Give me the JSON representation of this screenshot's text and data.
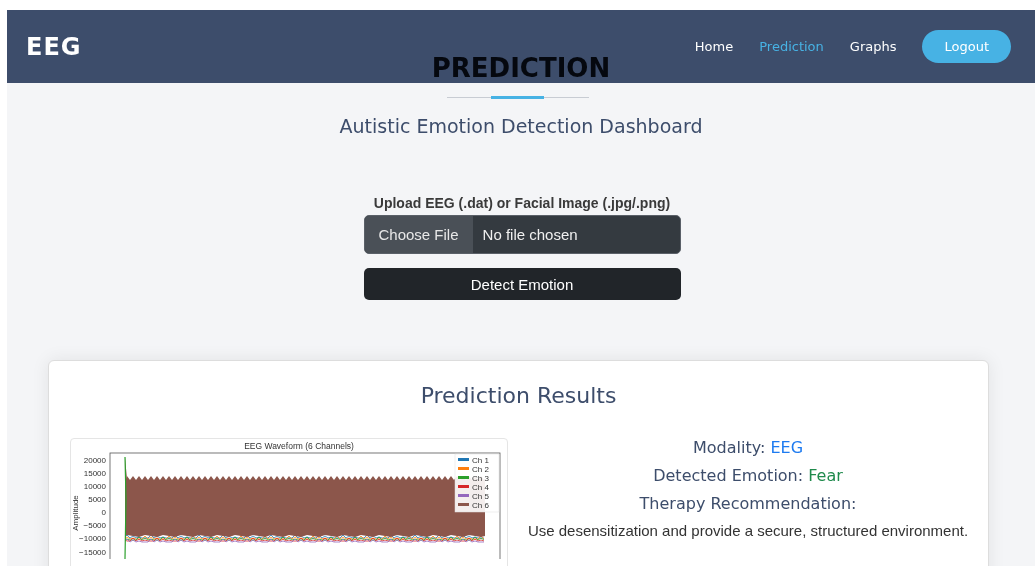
{
  "navbar": {
    "brand": "EEG",
    "links": [
      {
        "label": "Home",
        "selected": false
      },
      {
        "label": "Prediction",
        "selected": true
      },
      {
        "label": "Graphs",
        "selected": false
      }
    ],
    "logout": "Logout"
  },
  "page_title": "PREDICTION",
  "subtitle": "Autistic Emotion Detection Dashboard",
  "upload": {
    "label": "Upload EEG (.dat) or Facial Image (.jpg/.png)",
    "choose_button": "Choose File",
    "file_status": "No file chosen",
    "submit": "Detect Emotion"
  },
  "results": {
    "title": "Prediction Results",
    "eeg_plot": {
      "title": "EEG Waveform (6 Channels)",
      "y_label": "Amplitude",
      "y_ticks": [
        "20000",
        "15000",
        "10000",
        "5000",
        "0",
        "−5000",
        "−10000",
        "−15000"
      ],
      "legend": [
        {
          "label": "Ch 1",
          "color": "#1f77b4"
        },
        {
          "label": "Ch 2",
          "color": "#ff7f0e"
        },
        {
          "label": "Ch 3",
          "color": "#2ca02c"
        },
        {
          "label": "Ch 4",
          "color": "#d62728"
        },
        {
          "label": "Ch 5",
          "color": "#9467bd"
        },
        {
          "label": "Ch 6",
          "color": "#8c564b"
        }
      ]
    },
    "modality_label": "Modality:",
    "modality": "EEG",
    "emotion_label": "Detected Emotion:",
    "emotion": "Fear",
    "therapy_label": "Therapy Recommendation:",
    "therapy": "Use desensitization and provide a secure, structured environment."
  }
}
